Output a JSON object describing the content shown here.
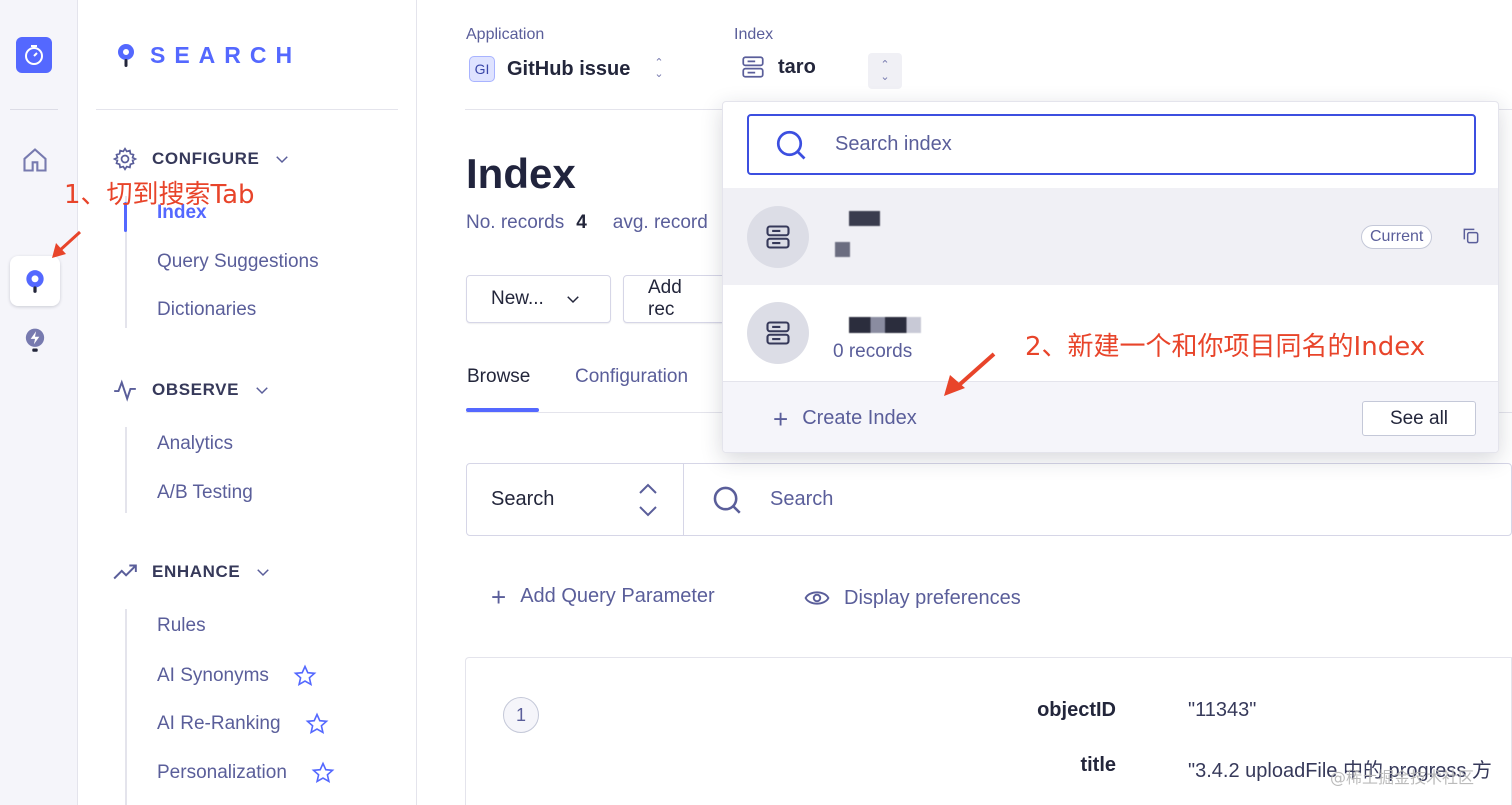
{
  "sidebar": {
    "brand": "SEARCH",
    "configure": {
      "title": "CONFIGURE",
      "items": [
        "Index",
        "Query Suggestions",
        "Dictionaries"
      ]
    },
    "observe": {
      "title": "OBSERVE",
      "items": [
        "Analytics",
        "A/B Testing"
      ]
    },
    "enhance": {
      "title": "ENHANCE",
      "items": [
        "Rules",
        "AI Synonyms",
        "AI Re-Ranking",
        "Personalization"
      ]
    }
  },
  "header": {
    "application_label": "Application",
    "application_badge": "GI",
    "application_value": "GitHub issue",
    "index_label": "Index",
    "index_value": "taro"
  },
  "main": {
    "title": "Index",
    "records_label": "No. records",
    "records_value": "4",
    "avg_label": "avg. record",
    "new_button": "New...",
    "add_button": "Add rec",
    "tabs": [
      "Browse",
      "Configuration"
    ],
    "search_scope": "Search",
    "search_placeholder": "Search",
    "add_query_param": "Add Query Parameter",
    "display_prefs": "Display preferences",
    "record": {
      "number": "1",
      "fields": [
        {
          "key": "objectID",
          "value": "\"11343\""
        },
        {
          "key": "title",
          "value": "\"3.4.2 uploadFile 中的 progress 方"
        }
      ]
    }
  },
  "dropdown": {
    "search_placeholder": "Search index",
    "current_badge": "Current",
    "other_records": "0 records",
    "create_label": "Create Index",
    "see_all": "See all"
  },
  "annotations": {
    "step1": "1、切到搜索Tab",
    "step2": "2、新建一个和你项目同名的Index"
  },
  "watermark": "@稀土掘金技术社区",
  "colors": {
    "accent": "#5468ff",
    "annotation": "#e8442a",
    "text": "#23263b",
    "muted": "#5a5e9a"
  }
}
